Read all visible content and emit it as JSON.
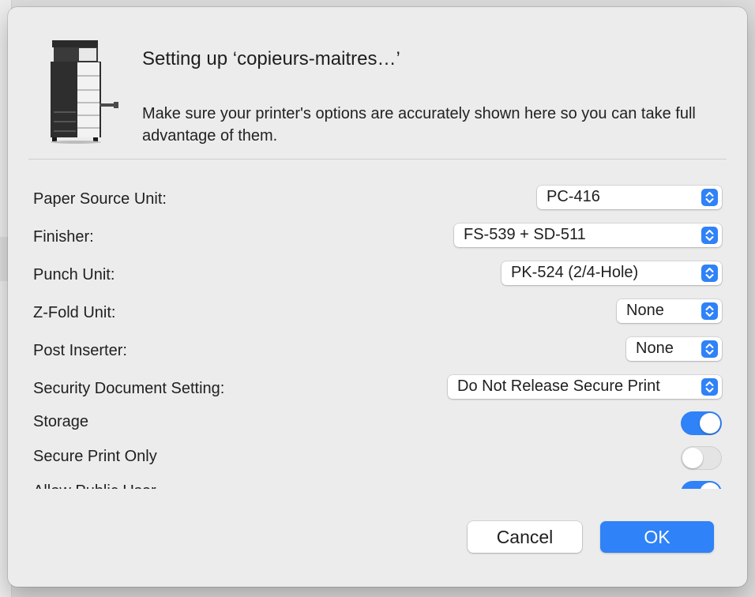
{
  "dialog": {
    "title": "Setting up ‘copieurs-maitres…’",
    "subtitle": "Make sure your printer's options are accurately shown here so you can take full advantage of them.",
    "icon": "printer-icon"
  },
  "options": {
    "paper_source": {
      "label": "Paper Source Unit:",
      "value": "PC-416"
    },
    "finisher": {
      "label": "Finisher:",
      "value": "FS-539 + SD-511"
    },
    "punch": {
      "label": "Punch Unit:",
      "value": "PK-524 (2/4-Hole)"
    },
    "zfold": {
      "label": "Z-Fold Unit:",
      "value": "None"
    },
    "post_inserter": {
      "label": "Post Inserter:",
      "value": "None"
    },
    "security": {
      "label": "Security Document Setting:",
      "value": "Do Not Release Secure Print"
    },
    "storage": {
      "label": "Storage",
      "enabled": true
    },
    "secure_print_only": {
      "label": "Secure Print Only",
      "enabled": false
    },
    "allow_public_user": {
      "label": "Allow Public User",
      "enabled": true
    }
  },
  "buttons": {
    "cancel": "Cancel",
    "ok": "OK"
  },
  "colors": {
    "accent": "#2f82f7",
    "sheet_background": "#ececec"
  }
}
